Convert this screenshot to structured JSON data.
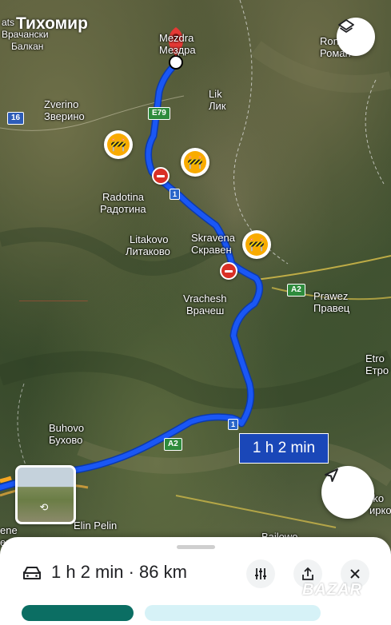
{
  "watermark": "Тихомир",
  "brand_mark": "BAZAR",
  "places": [
    {
      "latin": "Zverino",
      "cyrillic": "Зверино"
    },
    {
      "latin": "Lik",
      "cyrillic": "Лик"
    },
    {
      "latin": "Radotina",
      "cyrillic": "Радотина"
    },
    {
      "latin": "Litakovo",
      "cyrillic": "Литаково"
    },
    {
      "latin": "Skravena",
      "cyrillic": "Скравен"
    },
    {
      "latin": "Prawez",
      "cyrillic": "Правец"
    },
    {
      "latin": "Vrachesh",
      "cyrillic": "Врачеш"
    },
    {
      "latin": "Buhovo",
      "cyrillic": "Бухово"
    },
    {
      "latin": "Elin Pelin",
      "cyrillic": ""
    },
    {
      "latin": "Ron",
      "cyrillic": "Роман"
    },
    {
      "latin": "Etro",
      "cyrillic": "Етро"
    },
    {
      "latin": "rko",
      "cyrillic": "ирко"
    },
    {
      "latin": "Bailowo",
      "cyrillic": ""
    },
    {
      "latin": "ene",
      "cyrillic": "ене"
    }
  ],
  "top_left_region": {
    "line1": "ats",
    "line2": "Врачански",
    "line3": "Балкан"
  },
  "destination_label": {
    "line1": "Mezdra",
    "line2": "Мездра"
  },
  "road_shields": {
    "e79": "E79",
    "a2_east": "A2",
    "a2_west": "A2",
    "r16": "16",
    "r1_north": "1",
    "r1_south": "1"
  },
  "route": {
    "eta": "1 h 2 min"
  },
  "sheet": {
    "summary": "1 h 2 min · 86 km",
    "options_label": "⚙",
    "share_label": "⇪",
    "close_label": "✕"
  },
  "colors": {
    "route": "#1a57f5",
    "route_outline": "#0c3aad",
    "eta_bg": "#1a47b8",
    "warning": "#f9ab00",
    "closure": "#d93025",
    "destination_pin": "#e53935"
  },
  "icons": {
    "layers": "layers-icon",
    "locate": "navigation-arrow-icon",
    "car": "car-icon",
    "options": "tune-icon",
    "share": "share-icon",
    "close": "close-icon",
    "warning": "road-work-icon",
    "closure": "road-closed-icon",
    "pin": "destination-pin-icon"
  }
}
